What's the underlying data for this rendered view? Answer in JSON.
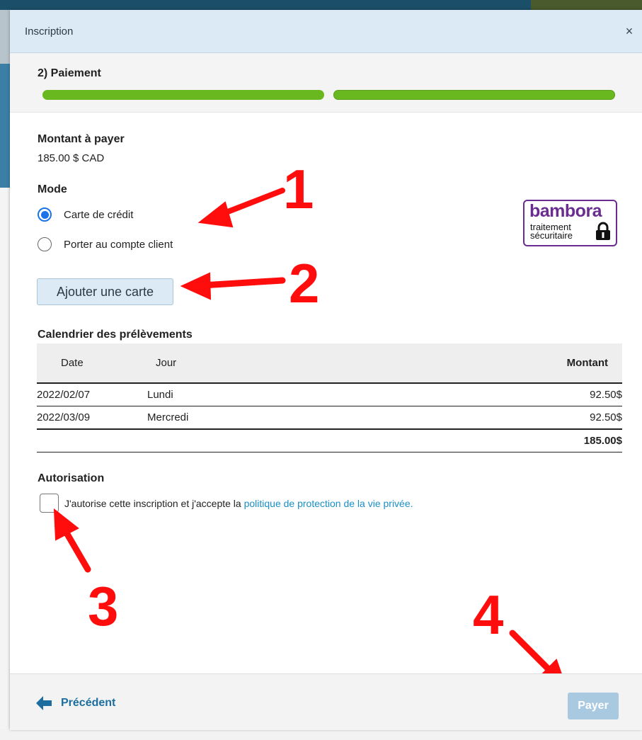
{
  "modal": {
    "title": "Inscription",
    "close_glyph": "×"
  },
  "step": {
    "title": "2) Paiement"
  },
  "progress": {
    "completed_segments": 2,
    "total_segments": 2,
    "color": "#6ab820"
  },
  "amount": {
    "label": "Montant à payer",
    "value": "185.00 $ CAD"
  },
  "mode": {
    "label": "Mode",
    "options": [
      {
        "label": "Carte de crédit",
        "selected": true
      },
      {
        "label": "Porter au compte client",
        "selected": false
      }
    ]
  },
  "bambora": {
    "name": "bambora",
    "line1": "traitement",
    "line2": "sécuritaire",
    "icon": "lock-icon",
    "color": "#6a2c91"
  },
  "add_card_button": "Ajouter une carte",
  "schedule": {
    "label": "Calendrier des prélèvements",
    "headers": {
      "date": "Date",
      "day": "Jour",
      "amount": "Montant"
    },
    "rows": [
      {
        "date": "2022/02/07",
        "day": "Lundi",
        "amount": "92.50$"
      },
      {
        "date": "2022/03/09",
        "day": "Mercredi",
        "amount": "92.50$"
      }
    ],
    "total": "185.00$"
  },
  "authorization": {
    "label": "Autorisation",
    "text": "J'autorise cette inscription et j'accepte la",
    "link": "politique de protection de la vie privée.",
    "checked": false
  },
  "annotations": {
    "n1": "1",
    "n2": "2",
    "n3": "3",
    "n4": "4",
    "color": "#ff0d0d"
  },
  "footer": {
    "previous_label": "Précédent",
    "pay_label": "Payer"
  }
}
